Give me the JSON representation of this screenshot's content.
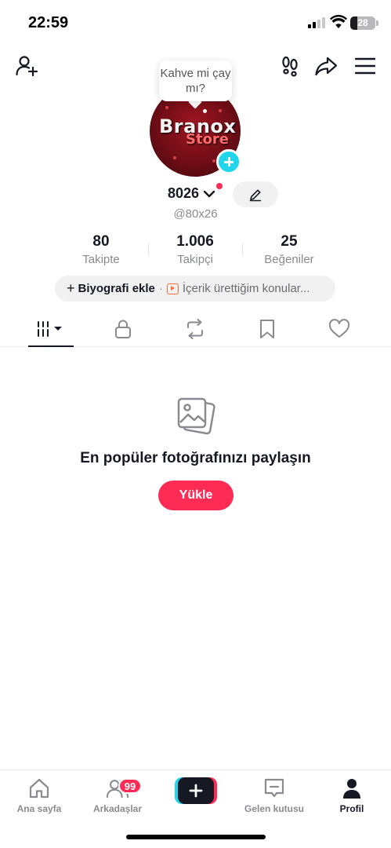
{
  "status_bar": {
    "time": "22:59",
    "battery": "28",
    "battery_level": 0.28
  },
  "profile": {
    "bubble_text": "Kahve mi çay mı?",
    "avatar_text_1": "Branox",
    "avatar_text_2": "Store",
    "name": "8026",
    "handle": "@80x26"
  },
  "stats": [
    {
      "value": "80",
      "label": "Takipte"
    },
    {
      "value": "1.006",
      "label": "Takipçi"
    },
    {
      "value": "25",
      "label": "Beğeniler"
    }
  ],
  "bio": {
    "add_label": "Biyografi ekle",
    "separator": "·",
    "topics_label": "İçerik ürettiğim konular..."
  },
  "tabs": [
    "videos-icon",
    "lock-icon",
    "repost-icon",
    "bookmark-icon",
    "heart-icon"
  ],
  "empty_state": {
    "title": "En popüler fotoğrafınızı paylaşın",
    "button": "Yükle"
  },
  "bottom_nav": {
    "home": "Ana sayfa",
    "friends": "Arkadaşlar",
    "friends_badge": "99",
    "inbox": "Gelen kutusu",
    "profile": "Profil"
  },
  "colors": {
    "accent": "#fe2c55",
    "cyan": "#20d5ec",
    "text": "#161823",
    "muted": "#8a8b91"
  }
}
